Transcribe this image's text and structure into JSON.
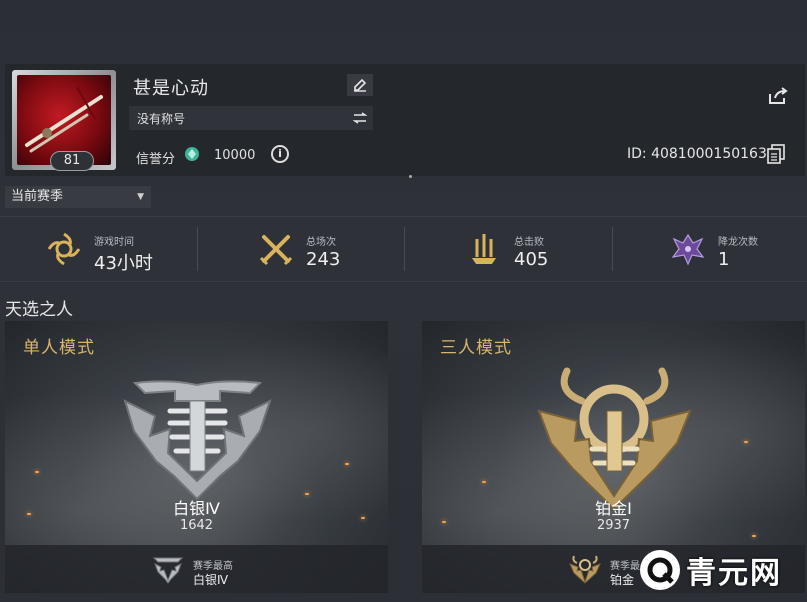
{
  "profile": {
    "name": "甚是心动",
    "title_text": "没有称号",
    "level": "81",
    "credit_label": "信誉分",
    "credit_value": "10000",
    "id_text": "ID: 4081000150163"
  },
  "season_select": {
    "value": "当前赛季"
  },
  "stats": [
    {
      "label": "游戏时间",
      "value": "43小时",
      "icon": "sun-swirl-icon"
    },
    {
      "label": "总场次",
      "value": "243",
      "icon": "crossed-swords-icon"
    },
    {
      "label": "总击败",
      "value": "405",
      "icon": "swords-in-ground-icon"
    },
    {
      "label": "降龙次数",
      "value": "1",
      "icon": "dragon-icon"
    }
  ],
  "section_title": "天选之人",
  "modes": [
    {
      "title": "单人模式",
      "rank_name": "白银Ⅳ",
      "rank_score": "1642",
      "best_label": "赛季最高",
      "best_rank": "白银Ⅳ",
      "emblem_color": "#b8bcc0"
    },
    {
      "title": "三人模式",
      "rank_name": "铂金Ⅰ",
      "rank_score": "2937",
      "best_label": "赛季最",
      "best_rank": "铂金",
      "emblem_color": "#c9ad74"
    }
  ],
  "watermark": {
    "text": "青元网"
  },
  "colors": {
    "accent_gold": "#d8b56a",
    "credit_icon": "#3fb39a",
    "background": "#2c3036"
  }
}
